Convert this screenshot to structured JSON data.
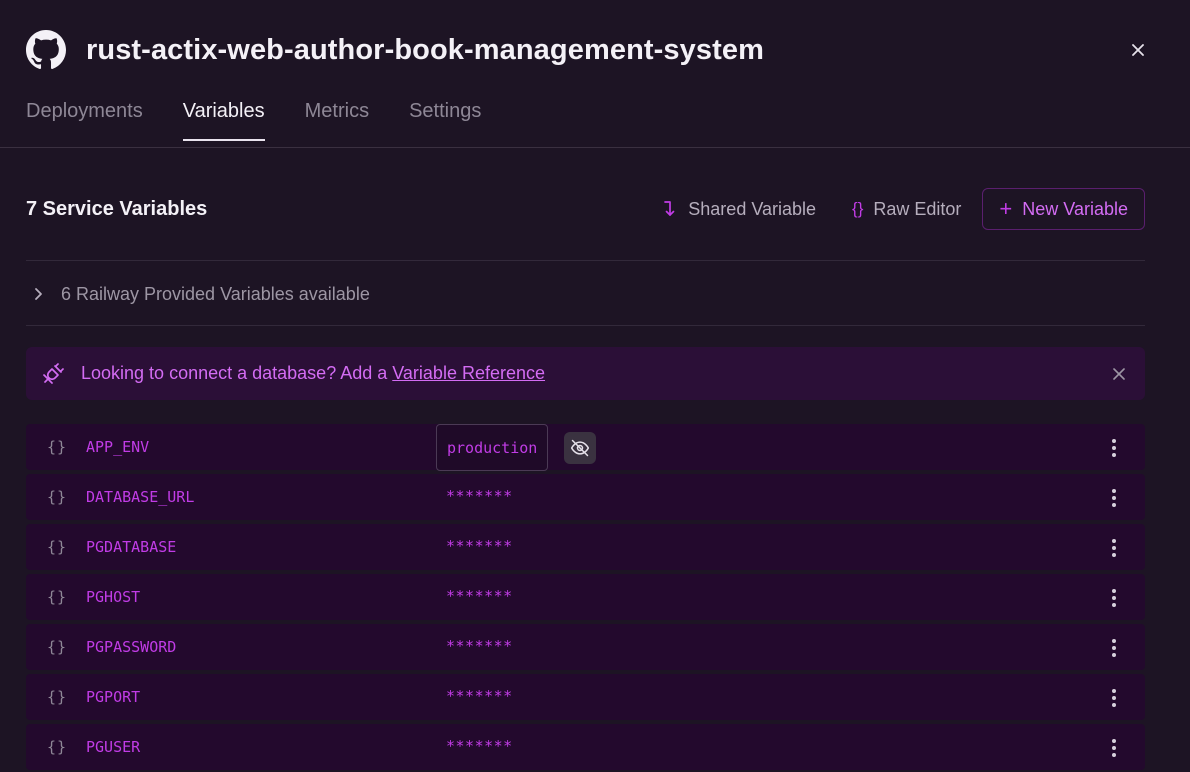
{
  "header": {
    "title": "rust-actix-web-author-book-management-system"
  },
  "tabs": [
    {
      "label": "Deployments"
    },
    {
      "label": "Variables"
    },
    {
      "label": "Metrics"
    },
    {
      "label": "Settings"
    }
  ],
  "active_tab": "Variables",
  "toolbar": {
    "count_label": "7 Service Variables",
    "shared_label": "Shared Variable",
    "raw_label": "Raw Editor",
    "raw_icon": "{}",
    "new_label": "New Variable",
    "new_icon": "+"
  },
  "provided": {
    "label": "6 Railway Provided Variables available"
  },
  "banner": {
    "text": "Looking to connect a database? Add a ",
    "link": "Variable Reference"
  },
  "variables": [
    {
      "icon": "{}",
      "name": "APP_ENV",
      "value": "production",
      "revealed": true
    },
    {
      "icon": "{}",
      "name": "DATABASE_URL",
      "value": "*******"
    },
    {
      "icon": "{}",
      "name": "PGDATABASE",
      "value": "*******"
    },
    {
      "icon": "{}",
      "name": "PGHOST",
      "value": "*******"
    },
    {
      "icon": "{}",
      "name": "PGPASSWORD",
      "value": "*******"
    },
    {
      "icon": "{}",
      "name": "PGPORT",
      "value": "*******"
    },
    {
      "icon": "{}",
      "name": "PGUSER",
      "value": "*******"
    }
  ],
  "colors": {
    "background": "#1d1424",
    "accent": "#c13ce6",
    "row_background": "#23092d"
  }
}
